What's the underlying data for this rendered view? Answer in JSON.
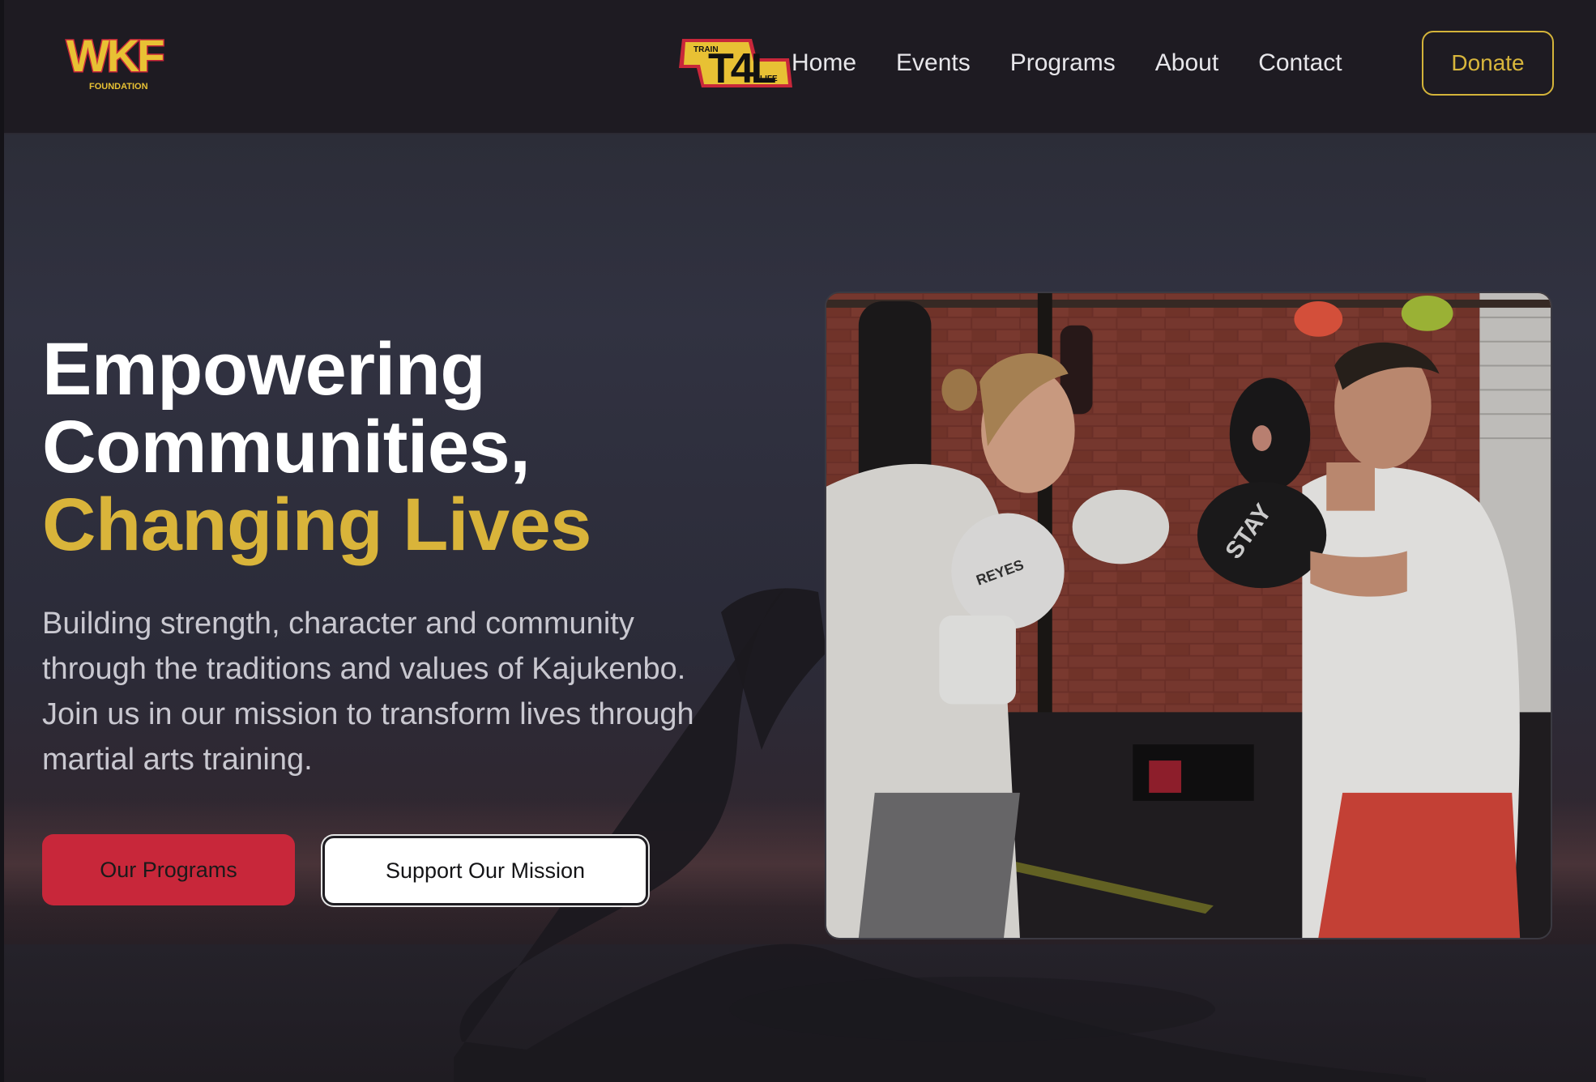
{
  "nav": {
    "logo_left": {
      "icon": "wkf-foundation-logo",
      "text": "WKF",
      "subtext": "FOUNDATION"
    },
    "logo_right": {
      "icon": "train-4-life-logo",
      "text": "T4L",
      "top": "TRAIN",
      "bottom": "LIFE"
    },
    "links": [
      "Home",
      "Events",
      "Programs",
      "About",
      "Contact"
    ],
    "donate_label": "Donate"
  },
  "hero": {
    "headline_line1": "Empowering",
    "headline_line2": "Communities,",
    "headline_line3": "Changing Lives",
    "description": "Building strength, character and community through the traditions and values of Kajukenbo. Join us in our mission to transform lives through martial arts training.",
    "primary_button": "Our Programs",
    "secondary_button": "Support Our Mission",
    "photo": "boxing-training-photo",
    "glove_text": "REYES",
    "pad_text": "STAY"
  },
  "colors": {
    "accent_gold": "#d9b43a",
    "primary_red": "#c8273a",
    "nav_bg": "#1e1b22",
    "text_light": "#e7e6ea"
  }
}
